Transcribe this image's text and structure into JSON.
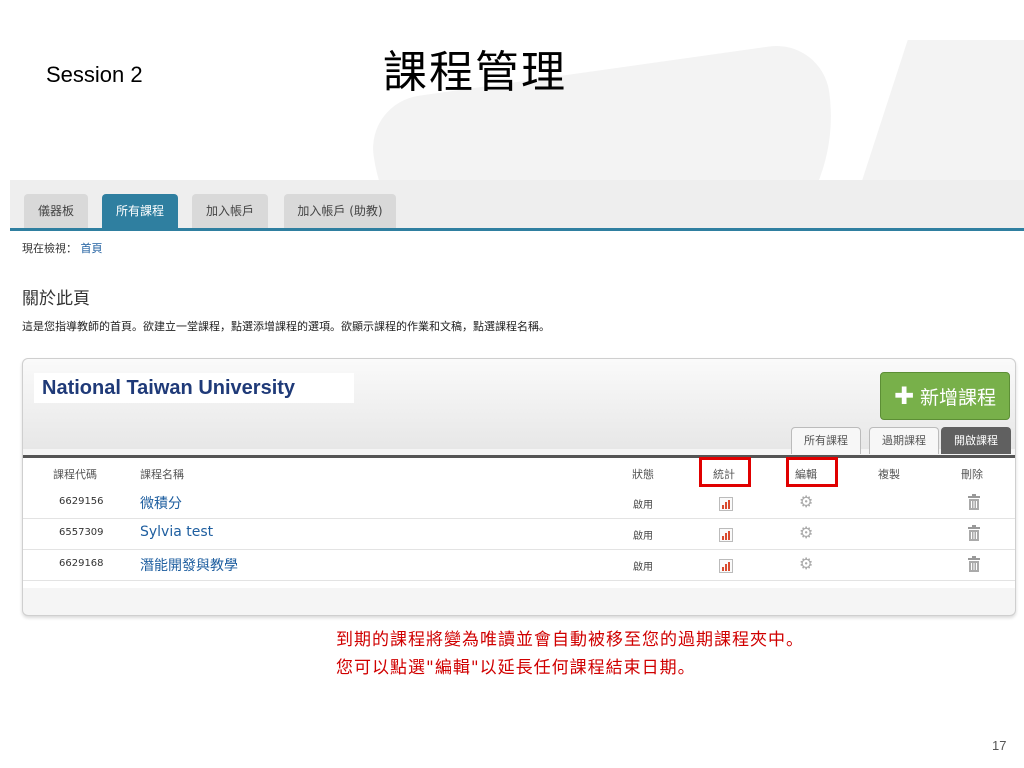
{
  "slide": {
    "session": "Session  2",
    "title": "課程管理",
    "page_number": "17",
    "note_line1": "到期的課程將變為唯讀並會自動被移至您的過期課程夾中。",
    "note_line2": "您可以點選\"編輯\"以延長任何課程結束日期。"
  },
  "tabs": [
    "儀器板",
    "所有課程",
    "加入帳戶",
    "加入帳戶 (助教)"
  ],
  "active_tab": "所有課程",
  "breadcrumb": {
    "label": "現在檢視：",
    "link": "首頁"
  },
  "about": {
    "title": "關於此頁",
    "text": "這是您指導教師的首頁。欲建立一堂課程，點選添增課程的選項。欲顯示課程的作業和文稿，點選課程名稱。"
  },
  "panel": {
    "institution": "National Taiwan University",
    "new_course_button": "新增課程",
    "filter_tabs": [
      "所有課程",
      "過期課程",
      "開啟課程"
    ],
    "active_filter": "開啟課程"
  },
  "table": {
    "headers": [
      "課程代碼",
      "課程名稱",
      "狀態",
      "統計",
      "編輯",
      "複製",
      "刪除"
    ],
    "rows": [
      {
        "code": "6629156",
        "name": "微積分",
        "status": "啟用"
      },
      {
        "code": "6557309",
        "name": "Sylvia test",
        "status": "啟用"
      },
      {
        "code": "6629168",
        "name": "潛能開發與教學",
        "status": "啟用"
      }
    ]
  },
  "icons": {
    "stats": "bar-chart-icon",
    "edit": "gear-icon",
    "delete": "trash-icon",
    "add": "plus-icon"
  },
  "colors": {
    "accent": "#2f7fa0",
    "button_green": "#78b04a",
    "highlight_red": "#e00000",
    "link_blue": "#1f5fa0"
  }
}
